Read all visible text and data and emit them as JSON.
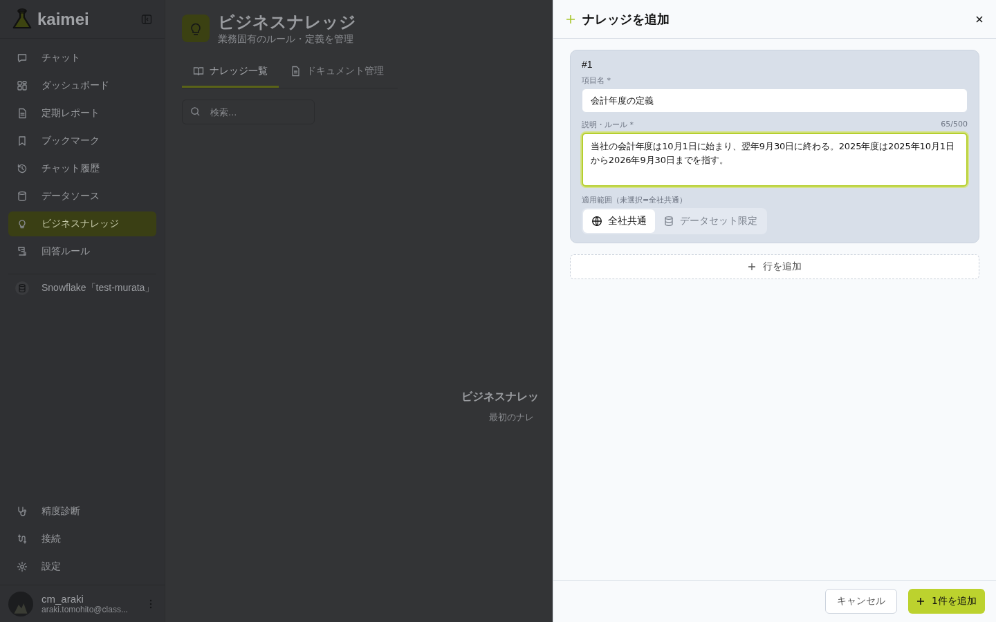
{
  "sidebar": {
    "logo": "kaimei",
    "nav": [
      {
        "label": "チャット",
        "selected": false
      },
      {
        "label": "ダッシュボード",
        "selected": false
      },
      {
        "label": "定期レポート",
        "selected": false
      },
      {
        "label": "ブックマーク",
        "selected": false
      },
      {
        "label": "チャット履歴",
        "selected": false
      },
      {
        "label": "データソース",
        "selected": false
      },
      {
        "label": "ビジネスナレッジ",
        "selected": true
      },
      {
        "label": "回答ルール",
        "selected": false
      }
    ],
    "data_source": "Snowflake「test-murata」",
    "bottom": [
      {
        "label": "精度診断"
      },
      {
        "label": "接続"
      },
      {
        "label": "設定"
      }
    ],
    "user": {
      "name": "cm_araki",
      "email": "araki.tomohito@class..."
    }
  },
  "main": {
    "title": "ビジネスナレッジ",
    "subtitle": "業務固有のルール・定義を管理",
    "tabs": [
      {
        "label": "ナレッジ一覧",
        "selected": true
      },
      {
        "label": "ドキュメント管理",
        "selected": false
      }
    ],
    "search": {
      "placeholder": "検索..."
    },
    "empty_state": {
      "title": "ビジネスナレッ",
      "text": "最初のナレ"
    }
  },
  "drawer": {
    "title": "ナレッジを追加",
    "entries": [
      {
        "number": "#1",
        "name_label": "項目名 *",
        "name_value": "会計年度の定義",
        "description_label": "説明・ルール *",
        "counter": "65/500",
        "description_value": "当社の会計年度は10月1日に始まり、翌年9月30日に終わる。2025年度は2025年10月1日から2026年9月30日までを指す。",
        "scope_label": "適用範囲（未選択=全社共通）",
        "scope_options": [
          {
            "label": "全社共通",
            "selected": true
          },
          {
            "label": "データセット限定",
            "selected": false
          }
        ]
      }
    ],
    "add_row": "行を追加",
    "cancel": "キャンセル",
    "submit": "1件を追加"
  }
}
